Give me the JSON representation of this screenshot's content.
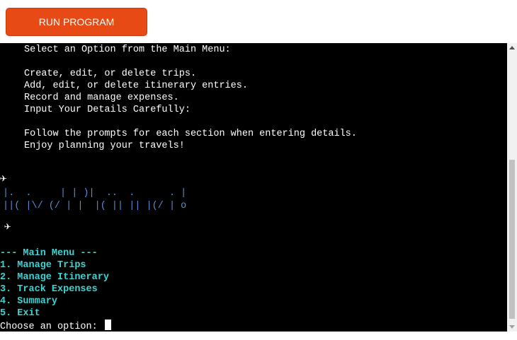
{
  "run_button": {
    "label": "RUN PROGRAM"
  },
  "terminal": {
    "intro": [
      "Select an Option from the Main Menu:",
      "Create, edit, or delete trips.",
      "Add, edit, or delete itinerary entries.",
      "Record and manage expenses.",
      "Input Your Details Carefully:",
      "Follow the prompts for each section when entering details.",
      "Enjoy planning your travels!"
    ],
    "plane_1": "✈",
    "banner_line_1": "|.  .     | | )|  ..  .      . |",
    "banner_line_2": "||( |\\/ (/ | |  |( || || |(/ | o",
    "plane_2": "✈",
    "menu_header": "--- Main Menu ---",
    "menu_items": [
      "1. Manage Trips",
      "2. Manage Itinerary",
      "3. Track Expenses",
      "4. Summary",
      "5. Exit"
    ],
    "prompt": "Choose an option:"
  },
  "colors": {
    "button_bg": "#e84a16",
    "terminal_bg": "#000000",
    "menu_text": "#3fd3d3",
    "banner_text": "#5b8fd6"
  }
}
